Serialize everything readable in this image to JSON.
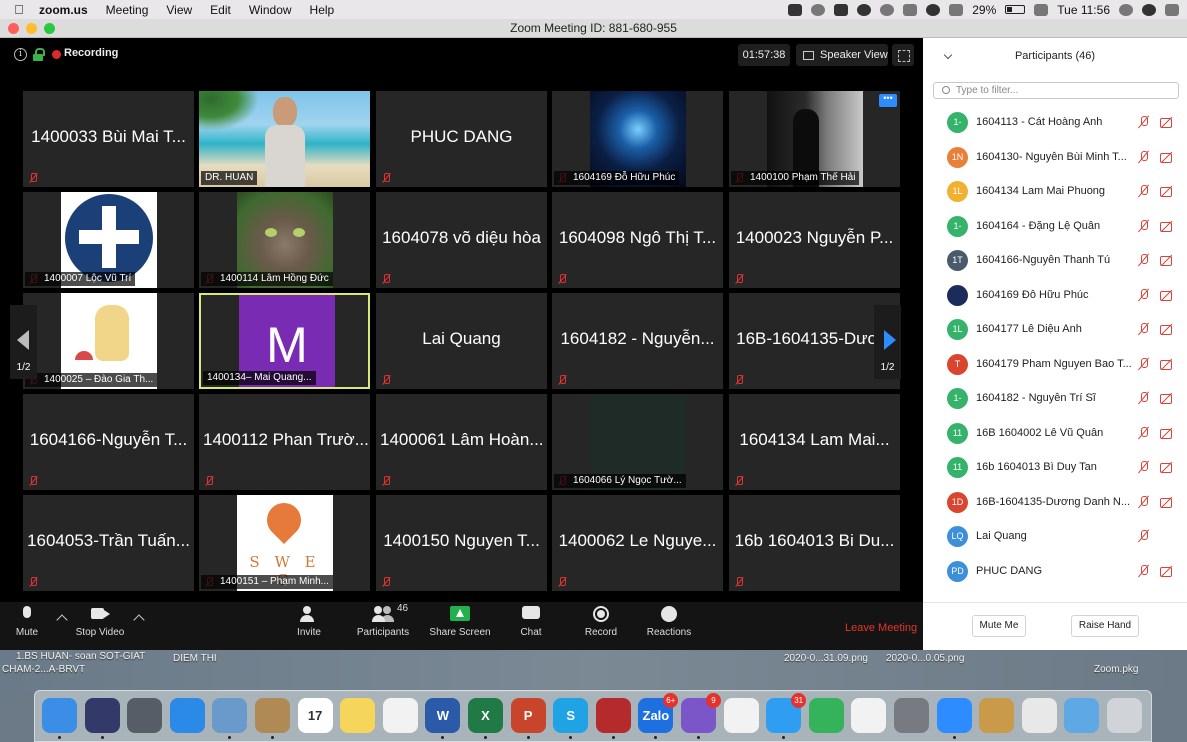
{
  "menubar": {
    "app": "zoom.us",
    "items": [
      "Meeting",
      "View",
      "Edit",
      "Window",
      "Help"
    ],
    "battery": "29%",
    "clock": "Tue 11:56"
  },
  "window": {
    "title": "Zoom Meeting ID: 881-680-955"
  },
  "meeting": {
    "recording_label": "Recording",
    "timer": "01:57:38",
    "view_label": "Speaker View",
    "page_left": "1/2",
    "page_right": "1/2"
  },
  "tiles": [
    {
      "big": "1400033 Bùi Mai T...",
      "small": ""
    },
    {
      "big": "",
      "small": "DR. HUAN"
    },
    {
      "big": "PHUC DANG",
      "small": ""
    },
    {
      "big": "",
      "small": "1604169 Đỗ Hữu Phúc"
    },
    {
      "big": "",
      "small": "1400100 Phạm Thế Hải"
    },
    {
      "big": "",
      "small": "1400007 Lộc Vũ Trí"
    },
    {
      "big": "",
      "small": "1400114 Lâm Hồng Đức"
    },
    {
      "big": "1604078 võ diệu hòa",
      "small": ""
    },
    {
      "big": "1604098 Ngô Thị T...",
      "small": ""
    },
    {
      "big": "1400023 Nguyễn P...",
      "small": ""
    },
    {
      "big": "",
      "small": "1400025 – Đào Gia Th..."
    },
    {
      "big": "",
      "small": "1400134– Mai Quang...",
      "initial": "M"
    },
    {
      "big": "Lai Quang",
      "small": ""
    },
    {
      "big": "1604182 - Nguyễn...",
      "small": ""
    },
    {
      "big": "16B-1604135-Dươ...",
      "small": ""
    },
    {
      "big": "1604166-Nguyễn T...",
      "small": ""
    },
    {
      "big": "1400112 Phan Trườ...",
      "small": ""
    },
    {
      "big": "1400061 Lâm Hoàn...",
      "small": ""
    },
    {
      "big": "",
      "small": "1604066 Lý Ngọc Tườ..."
    },
    {
      "big": "1604134 Lam Mai...",
      "small": ""
    },
    {
      "big": "1604053-Trần Tuấn...",
      "small": ""
    },
    {
      "big": "",
      "small": "1400151 – Phạm Minh...",
      "logo": "S W E C"
    },
    {
      "big": "1400150 Nguyen T...",
      "small": ""
    },
    {
      "big": "1400062 Le Nguye...",
      "small": ""
    },
    {
      "big": "16b 1604013 Bi Du...",
      "small": ""
    }
  ],
  "toolbar": {
    "mute": "Mute",
    "stop_video": "Stop Video",
    "invite": "Invite",
    "participants": "Participants",
    "participants_count": "46",
    "share_screen": "Share Screen",
    "chat": "Chat",
    "record": "Record",
    "reactions": "Reactions",
    "leave": "Leave Meeting"
  },
  "panel": {
    "title": "Participants (46)",
    "filter_placeholder": "Type to filter...",
    "participants": [
      {
        "initials": "1-",
        "color": "#35b36a",
        "name": "1604113 - Cát Hoàng Anh"
      },
      {
        "initials": "1N",
        "color": "#e8803a",
        "name": "1604130- Nguyễn Bùi Minh T..."
      },
      {
        "initials": "1L",
        "color": "#f0b030",
        "name": "1604134 Lam Mai Phuong"
      },
      {
        "initials": "1-",
        "color": "#35b36a",
        "name": "1604164 - Đặng Lệ Quân"
      },
      {
        "initials": "1T",
        "color": "#4a5a6a",
        "name": "1604166-Nguyễn Thanh  Tú"
      },
      {
        "initials": "",
        "color": "#1b2b5a",
        "name": "1604169 Đỗ Hữu Phúc"
      },
      {
        "initials": "1L",
        "color": "#35b36a",
        "name": "1604177 Lê Diệu Anh"
      },
      {
        "initials": "T",
        "color": "#d9452f",
        "name": "1604179 Pham Nguyen Bao T..."
      },
      {
        "initials": "1-",
        "color": "#35b36a",
        "name": "1604182 - Nguyễn Trí Sĩ"
      },
      {
        "initials": "11",
        "color": "#35b36a",
        "name": "16B 1604002 Lê Vũ Quân"
      },
      {
        "initials": "11",
        "color": "#35b36a",
        "name": "16b 1604013 Bì Duy Tan"
      },
      {
        "initials": "1D",
        "color": "#d9452f",
        "name": "16B-1604135-Dương Danh N..."
      },
      {
        "initials": "LQ",
        "color": "#3d8fd9",
        "name": "Lai Quang"
      },
      {
        "initials": "PD",
        "color": "#3d8fd9",
        "name": "PHUC DANG"
      }
    ],
    "mute_me": "Mute Me",
    "raise_hand": "Raise Hand"
  },
  "desktop": {
    "files": [
      "1.BS HUAN-  soan SOT-GIAT",
      "CHAM-2...A-BRVT",
      "DIEM THI",
      "2020-0...31.09.png",
      "2020-0...0.05.png",
      "Zoom.pkg"
    ]
  },
  "dock": {
    "apps": [
      {
        "name": "finder",
        "label": "",
        "color": "#3a8ee6"
      },
      {
        "name": "siri",
        "label": "",
        "color": "#333a6a"
      },
      {
        "name": "launchpad",
        "label": "",
        "color": "#555d66"
      },
      {
        "name": "safari",
        "label": "",
        "color": "#2b89e8"
      },
      {
        "name": "preview",
        "label": "",
        "color": "#6a9acb"
      },
      {
        "name": "contacts",
        "label": "",
        "color": "#b08a55"
      },
      {
        "name": "calendar",
        "label": "17",
        "color": "#ffffff"
      },
      {
        "name": "notes",
        "label": "",
        "color": "#f6d65a"
      },
      {
        "name": "reminders",
        "label": "",
        "color": "#f2f2f2"
      },
      {
        "name": "word",
        "label": "W",
        "color": "#2b5aa8"
      },
      {
        "name": "excel",
        "label": "X",
        "color": "#1f7a45"
      },
      {
        "name": "powerpoint",
        "label": "P",
        "color": "#c8452b"
      },
      {
        "name": "skype",
        "label": "S",
        "color": "#1fa3e5"
      },
      {
        "name": "acrobat",
        "label": "",
        "color": "#b52b2b"
      },
      {
        "name": "zalo",
        "label": "Zalo",
        "color": "#1e6fe0",
        "badge": "6+"
      },
      {
        "name": "viber",
        "label": "",
        "color": "#7a56c8",
        "badge": "9"
      },
      {
        "name": "photos",
        "label": "",
        "color": "#f2f2f2"
      },
      {
        "name": "messenger",
        "label": "",
        "color": "#2f9ef2",
        "badge": "31"
      },
      {
        "name": "facetime",
        "label": "",
        "color": "#35b35a"
      },
      {
        "name": "music",
        "label": "",
        "color": "#f2f2f2"
      },
      {
        "name": "system-preferences",
        "label": "",
        "color": "#777a80"
      },
      {
        "name": "zoom",
        "label": "",
        "color": "#2d8cff"
      },
      {
        "name": "archive",
        "label": "",
        "color": "#c99a4a"
      },
      {
        "name": "printer",
        "label": "",
        "color": "#e8e8e8"
      },
      {
        "name": "folder",
        "label": "",
        "color": "#5fa8e6"
      },
      {
        "name": "trash",
        "label": "",
        "color": "#d0d4d8"
      }
    ]
  }
}
